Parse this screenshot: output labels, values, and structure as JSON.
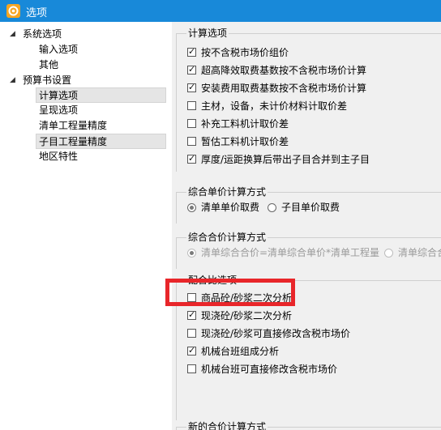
{
  "window": {
    "title": "选项",
    "accent_color": "#1889d9"
  },
  "tree": {
    "groups": [
      {
        "label": "系统选项",
        "expanded": true,
        "children": [
          "输入选项",
          "其他"
        ]
      },
      {
        "label": "预算书设置",
        "expanded": true,
        "children": [
          "计算选项",
          "呈现选项",
          "清单工程量精度",
          "子目工程量精度",
          "地区特性"
        ]
      }
    ],
    "selected": "子目工程量精度"
  },
  "calc_options": {
    "title": "计算选项",
    "items": [
      {
        "label": "按不含税市场价组价",
        "checked": true
      },
      {
        "label": "超高降效取费基数按不含税市场价计算",
        "checked": true
      },
      {
        "label": "安装费用取费基数按不含税市场价计算",
        "checked": true
      },
      {
        "label": "主材，设备，未计价材料计取价差",
        "checked": false
      },
      {
        "label": "补充工料机计取价差",
        "checked": false
      },
      {
        "label": "暂估工料机计取价差",
        "checked": false
      },
      {
        "label": "厚度/运距换算后带出子目合并到主子目",
        "checked": true
      }
    ]
  },
  "unit_price_method": {
    "title": "综合单价计算方式",
    "options": [
      {
        "label": "清单单价取费",
        "selected": true
      },
      {
        "label": "子目单价取费",
        "selected": false
      }
    ]
  },
  "total_price_method": {
    "title": "综合合价计算方式",
    "options": [
      {
        "label": "清单综合合价=清单综合单价*清单工程量",
        "selected": true
      },
      {
        "label": "清单综合合",
        "selected": false
      }
    ]
  },
  "mix_analysis": {
    "title": "配合比选项",
    "items": [
      {
        "label": "商品砼/砂浆二次分析",
        "checked": false
      },
      {
        "label": "现浇砼/砂浆二次分析",
        "checked": true
      },
      {
        "label": "现浇砼/砂浆可直接修改含税市场价",
        "checked": false
      },
      {
        "label": "机械台班组成分析",
        "checked": true
      },
      {
        "label": "机械台班可直接修改含税市场价",
        "checked": false
      }
    ]
  },
  "next_group": {
    "title": "新的合价计算方式"
  },
  "highlight": {
    "color": "#e8262a"
  }
}
